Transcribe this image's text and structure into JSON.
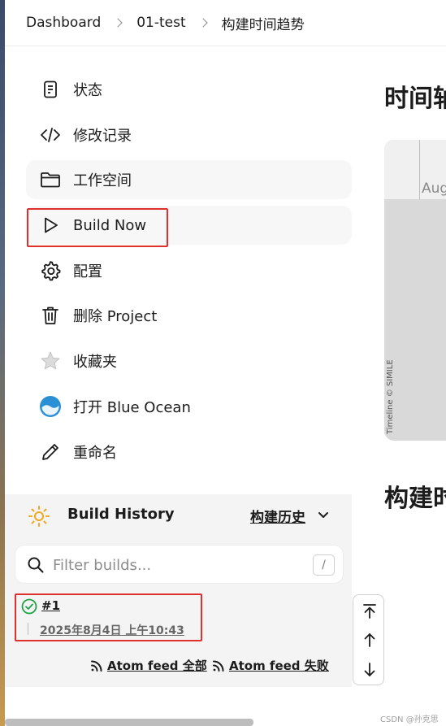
{
  "breadcrumb": {
    "items": [
      {
        "label": "Dashboard"
      },
      {
        "label": "01-test"
      },
      {
        "label": "构建时间趋势"
      }
    ]
  },
  "side_nav": {
    "items": [
      {
        "label": "状态",
        "icon": "document-icon"
      },
      {
        "label": "修改记录",
        "icon": "code-icon"
      },
      {
        "label": "工作空间",
        "icon": "folder-icon"
      },
      {
        "label": "Build Now",
        "icon": "play-icon"
      },
      {
        "label": "配置",
        "icon": "gear-icon"
      },
      {
        "label": "删除 Project",
        "icon": "trash-icon"
      },
      {
        "label": "收藏夹",
        "icon": "star-icon"
      },
      {
        "label": "打开 Blue Ocean",
        "icon": "blue-ocean-icon"
      },
      {
        "label": "重命名",
        "icon": "pencil-icon"
      }
    ]
  },
  "build_history": {
    "title": "Build History",
    "trend_link": "构建历史",
    "filter_placeholder": "Filter builds...",
    "filter_shortcut": "/",
    "builds": [
      {
        "number": "#1",
        "date": "2025年8月4日 上午10:43",
        "status": "success"
      }
    ],
    "atom_all": "Atom feed 全部",
    "atom_failed": "Atom feed 失败"
  },
  "main": {
    "heading_timeline": "时间轴",
    "timeline_label": "Aug",
    "timeline_credit": "Timeline © SIMILE",
    "heading_trend": "构建时"
  },
  "watermark": "CSDN @孙克思",
  "colors": {
    "highlight": "#e0302e",
    "success": "#1ea446",
    "panel_bg": "#f4f4f5"
  }
}
